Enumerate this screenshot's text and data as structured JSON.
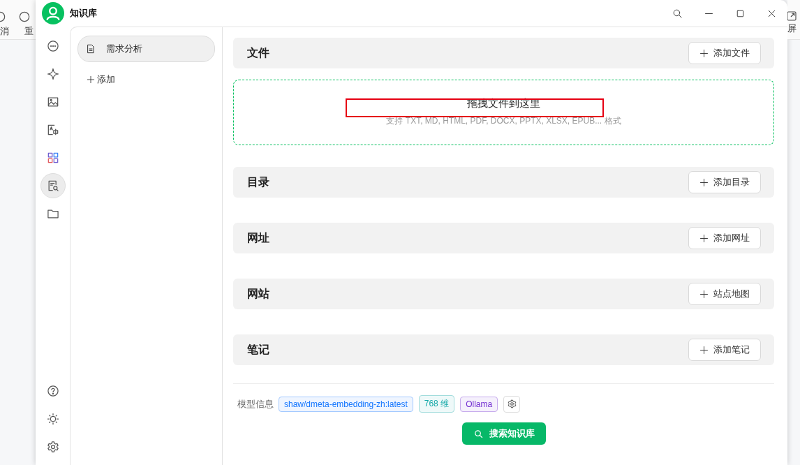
{
  "background_app": {
    "left_labels": [
      "消",
      "重"
    ],
    "right_label": "屏"
  },
  "window": {
    "title": "知识库"
  },
  "nav_rail": {
    "top": [
      {
        "kind": "chat",
        "selected": false
      },
      {
        "kind": "sparkle",
        "selected": false
      },
      {
        "kind": "image",
        "selected": false
      },
      {
        "kind": "translate",
        "selected": false
      },
      {
        "kind": "apps",
        "selected": false
      },
      {
        "kind": "knowledge",
        "selected": true
      },
      {
        "kind": "folder",
        "selected": false
      }
    ],
    "bottom": [
      {
        "kind": "help",
        "selected": false
      },
      {
        "kind": "theme",
        "selected": false
      },
      {
        "kind": "settings",
        "selected": false
      }
    ]
  },
  "knowledge_bases": {
    "items": [
      {
        "name": "需求分析",
        "selected": true
      }
    ],
    "add_label": "添加"
  },
  "sections": [
    {
      "title": "文件",
      "button": "添加文件",
      "dropzone": {
        "title": "拖拽文件到这里",
        "hint": "支持 TXT, MD, HTML, PDF, DOCX, PPTX, XLSX, EPUB... 格式",
        "annotation": {
          "kind": "rectangle",
          "color": "#e60012"
        }
      }
    },
    {
      "title": "目录",
      "button": "添加目录"
    },
    {
      "title": "网址",
      "button": "添加网址"
    },
    {
      "title": "网站",
      "button": "站点地图"
    },
    {
      "title": "笔记",
      "button": "添加笔记"
    }
  ],
  "model_info": {
    "label": "模型信息",
    "tags": [
      {
        "text": "shaw/dmeta-embedding-zh:latest",
        "color": "#1677ff"
      },
      {
        "text": "768 维",
        "color": "#13a8a8"
      },
      {
        "text": "Ollama",
        "color": "#722ed1"
      }
    ]
  },
  "search_button": "搜索知识库"
}
